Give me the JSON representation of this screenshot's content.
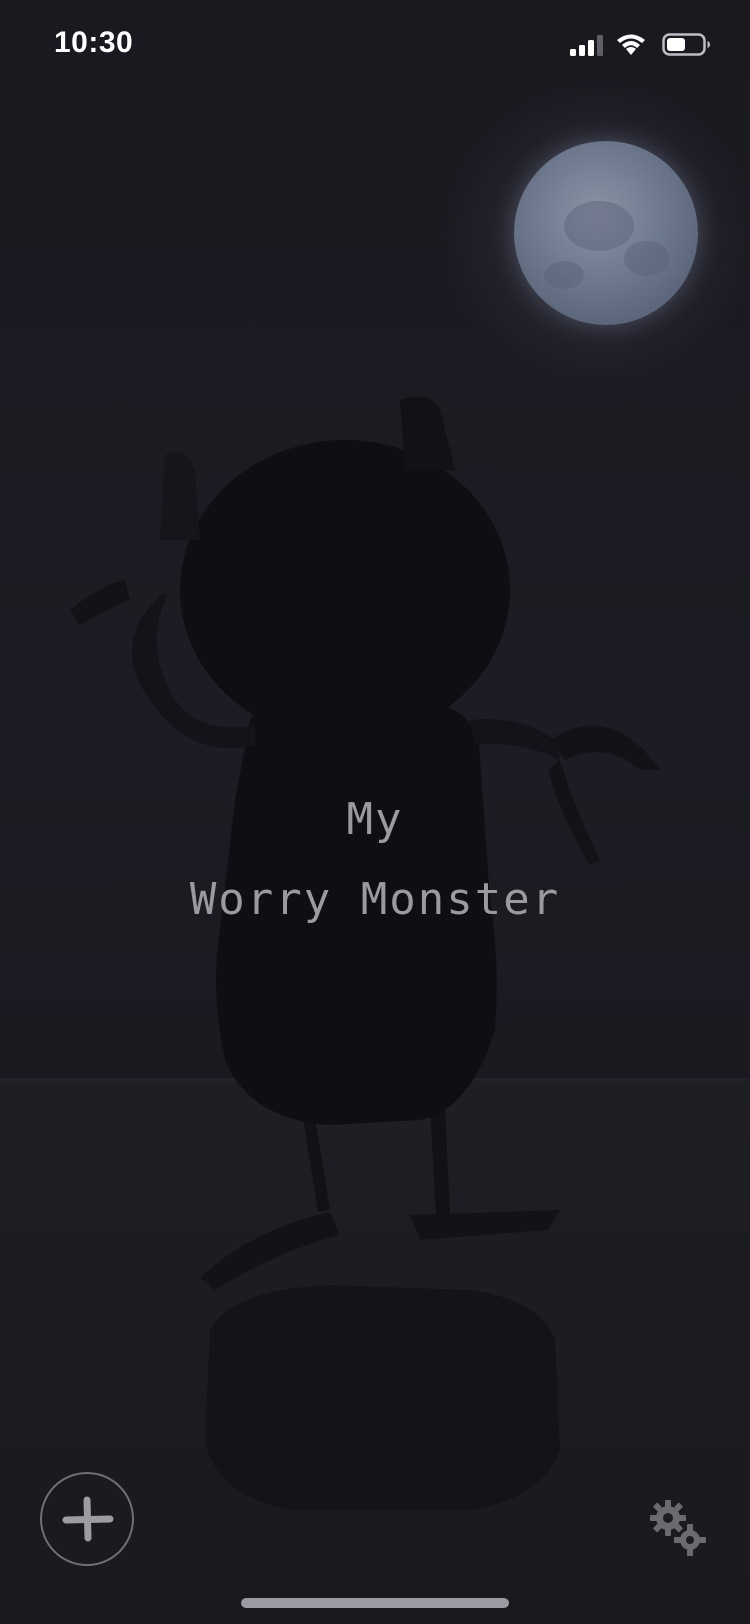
{
  "status_bar": {
    "time": "10:30"
  },
  "title": {
    "line1": "My",
    "line2": "Worry Monster"
  },
  "icons": {
    "add": "plus-icon",
    "settings": "gears-icon",
    "signal": "cellular-signal-icon",
    "wifi": "wifi-icon",
    "battery": "battery-icon"
  },
  "colors": {
    "background": "#17161c",
    "title_text": "#9a9aa0",
    "moon": "#707b90"
  }
}
